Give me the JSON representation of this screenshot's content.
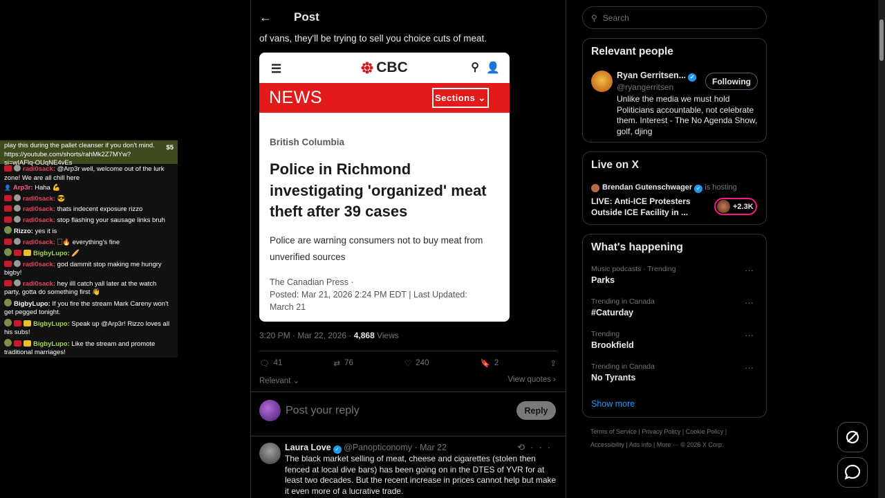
{
  "chat": {
    "donation": {
      "text": "play this during the pallet cleanser if you don't mind. https://youtube.com/shorts/rahMk2Z7MYw?si=wIAFlq-OUqNE4vEs",
      "amount": "$5"
    },
    "messages": [
      {
        "user": "radi0sack:",
        "text": " @Arp3r well, welcome out of the lurk zone! We are all chill here",
        "color": "u-red",
        "badges": [
          "red",
          "gray"
        ]
      },
      {
        "user": "Arp3r:",
        "text": " Haha 💪",
        "color": "u-pink",
        "badges": [
          "person"
        ]
      },
      {
        "user": "radi0sack:",
        "text": " 😎",
        "color": "u-red",
        "badges": [
          "red",
          "gray"
        ]
      },
      {
        "user": "radi0sack:",
        "text": " thats indecent exposure rizzo",
        "color": "u-red",
        "badges": [
          "red",
          "gray"
        ]
      },
      {
        "user": "radi0sack:",
        "text": " stop flashing your sausage links bruh",
        "color": "u-red",
        "badges": [
          "red",
          "gray"
        ]
      },
      {
        "user": "Rizzo:",
        "text": " yes it is",
        "color": "u-white",
        "badges": [
          "av"
        ]
      },
      {
        "user": "radi0sack:",
        "text": " 🗌🔥 everything's fine",
        "color": "u-red",
        "badges": [
          "red",
          "gray"
        ]
      },
      {
        "user": "BigbyLupo:",
        "text": " 🥖",
        "color": "u-green",
        "badges": [
          "av",
          "red",
          "yel"
        ]
      },
      {
        "user": "radi0sack:",
        "text": " god dammit stop making me hungry bigby!",
        "color": "u-red",
        "badges": [
          "red",
          "gray"
        ]
      },
      {
        "user": "radi0sack:",
        "text": " hey illl catch yall later at the watch party, gotta do something first 👋",
        "color": "u-red",
        "badges": [
          "red",
          "gray"
        ]
      },
      {
        "user": "BigbyLupo:",
        "text": " If you fire the stream Mark Careny won't get pegged tonight.",
        "color": "u-white",
        "badges": [
          "av"
        ]
      },
      {
        "user": "BigbyLupo:",
        "text": " Speak up @Arp3r! Rizzo loves all his subs!",
        "color": "u-green",
        "badges": [
          "av",
          "red",
          "yel"
        ]
      },
      {
        "user": "BigbyLupo:",
        "text": " Like the stream and promote traditional marriages!",
        "color": "u-green",
        "badges": [
          "av",
          "red",
          "yel"
        ]
      }
    ]
  },
  "post": {
    "header_title": "Post",
    "tweet_text": "of vans, they'll be trying to sell you choice cuts of meat.",
    "card": {
      "logo": "CBC",
      "news_label": "NEWS",
      "sections_label": "Sections ⌄",
      "kicker": "British Columbia",
      "headline": "Police in Richmond investigating 'organized' meat theft after 39 cases",
      "dek": "Police are warning consumers not to buy meat from unverified sources",
      "source": "The Canadian Press ·",
      "dates": "Posted: Mar 21, 2026 2:24 PM EDT | Last Updated: March 21"
    },
    "meta_time": "3:20 PM · Mar 22, 2026 · ",
    "views_count": "4,868",
    "views_label": " Views",
    "actions": {
      "replies": "41",
      "reposts": "76",
      "likes": "240",
      "bookmarks": "2"
    },
    "relevant_label": "Relevant ⌄",
    "view_quotes": "View quotes ›",
    "reply_placeholder": "Post your reply",
    "reply_button": "Reply"
  },
  "reply_tweet": {
    "name": "Laura Love",
    "handle_date": "@Panopticonomy · Mar 22",
    "text": "The black market selling of meat, cheese and cigarettes (stolen then fenced at local dive bars) has been going on in the DTES of YVR for at least two decades. But the recent increase in prices cannot help but make it even more of a lucrative trade."
  },
  "sidebar": {
    "search_placeholder": "Search",
    "relevant_people": {
      "title": "Relevant people",
      "name": "Ryan Gerritsen...",
      "handle": "@ryangerritsen",
      "follow_label": "Following",
      "bio": "Unlike the media we must hold Politicians accountable, not celebrate them. Interest - The No Agenda Show, golf, djing"
    },
    "live": {
      "title": "Live on X",
      "host_name": "Brendan Gutenschwager",
      "host_suffix": " is hosting",
      "broadcast_title": "LIVE: Anti-ICE Protesters Outside ICE Facility in ...",
      "listeners": "+2.3K"
    },
    "happening": {
      "title": "What's happening",
      "trends": [
        {
          "context": "Music podcasts · Trending",
          "name": "Parks"
        },
        {
          "context": "Trending in Canada",
          "name": "#Caturday"
        },
        {
          "context": "Trending",
          "name": "Brookfield"
        },
        {
          "context": "Trending in Canada",
          "name": "No Tyrants"
        }
      ],
      "show_more": "Show more"
    },
    "footer": {
      "line1": "Terms of Service  |   Privacy Policy  |   Cookie Policy  |",
      "line2": "Accessibility  |   Ads info  |   More ···   © 2026 X Corp."
    }
  }
}
